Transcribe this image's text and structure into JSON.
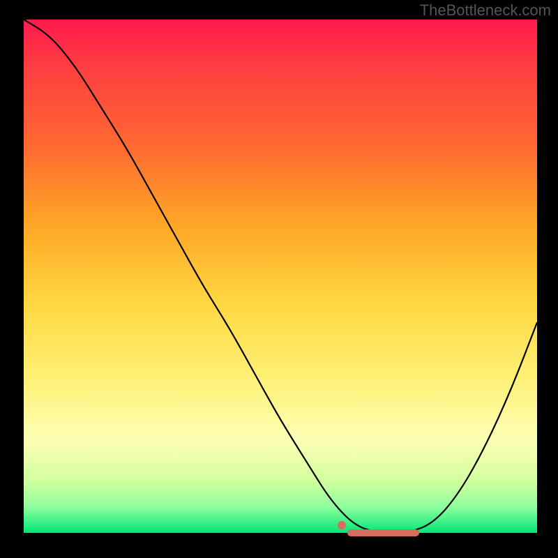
{
  "watermark": "TheBottleneck.com",
  "chart_data": {
    "type": "line",
    "title": "",
    "xlabel": "",
    "ylabel": "",
    "xlim": [
      0,
      100
    ],
    "ylim": [
      0,
      100
    ],
    "x": [
      0,
      5,
      10,
      15,
      20,
      25,
      30,
      35,
      40,
      45,
      50,
      55,
      60,
      65,
      70,
      75,
      80,
      85,
      90,
      95,
      100
    ],
    "y": [
      100,
      97,
      91,
      83,
      75,
      66,
      57,
      48,
      40,
      31,
      22,
      14,
      6,
      1,
      0,
      0,
      2,
      8,
      17,
      28,
      41
    ],
    "highlight": {
      "x_start": 63,
      "x_end": 77,
      "y": 0,
      "dot_x": 62,
      "dot_y": 1.5
    },
    "gradient_colors": [
      "#ff1a4d",
      "#ff6a30",
      "#ffd740",
      "#fdffb6",
      "#00e676"
    ]
  }
}
